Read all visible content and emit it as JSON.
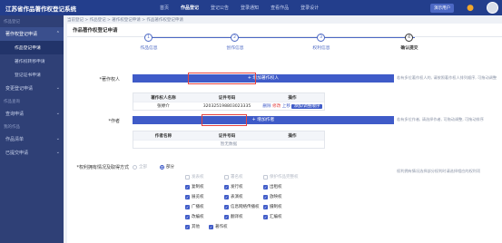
{
  "topbar": {
    "brand": "江苏省作品著作权登记系统",
    "nav": [
      "首页",
      "作品登记",
      "登记公告",
      "登录通知",
      "查看作品",
      "登录设计"
    ],
    "active_nav": 1,
    "user_btn": "演示用户"
  },
  "sidebar": {
    "group1": "作品登记",
    "item_apply": "著作权登记申请",
    "sub_items": [
      "作品登记申请",
      "著作权转移申请",
      "登记证书申请"
    ],
    "item_change": "变更登记申请",
    "group2": "作品查询",
    "item_query": "查询申请",
    "group3": "我的作品",
    "item_my": "作品清单",
    "item_done": "已提交申请"
  },
  "breadcrumb": "当前登记 > 作品登记 > 著作权登记申请 > 作品著作权登记申请",
  "page_title": "作品著作权登记申请",
  "steps": [
    {
      "num": "1",
      "label": "作品信息"
    },
    {
      "num": "2",
      "label": "创作信息"
    },
    {
      "num": "3",
      "label": "权利信息"
    },
    {
      "num": "4",
      "label": "确认提交"
    }
  ],
  "applicant": {
    "label": "*著作权人",
    "add_button": "+ 增加著作权人",
    "table_headers": [
      "著作权人名称",
      "证件号码",
      "操作"
    ],
    "rows": [
      {
        "name": "张婷介",
        "id_number": "320325198803023335",
        "ops": [
          "删除",
          "修改",
          "上移"
        ],
        "tag": "添加/调整顺序"
      }
    ],
    "hint": "若有多位著作权人的, 请按照著作权人排列顺序, 可拖动调整"
  },
  "author": {
    "label": "*作者",
    "add_button": "+ 增加作者",
    "table_headers": [
      "作者名称",
      "证件号码",
      "操作"
    ],
    "empty": "暂无数据",
    "hint": "若有多位作者, 请选择作者, 可拖动调整, 可拖动排序"
  },
  "rights": {
    "label": "*权利拥有情况及取得方式",
    "radio_all": "全部",
    "radio_part": "部分",
    "hint": "权利拥有情况选择部分权利时请选择相应的权利项",
    "row1": [
      "发表权",
      "署名权",
      "保护作品完整权"
    ],
    "row2": [
      "复制权",
      "发行权",
      "出租权"
    ],
    "row3": [
      "展览权",
      "表演权",
      "放映权"
    ],
    "row4": [
      "广播权",
      "信息网络传播权",
      "摄制权"
    ],
    "row5": [
      "改编权",
      "翻译权",
      "汇编权"
    ],
    "row6": [
      "其他",
      "著作权"
    ]
  }
}
